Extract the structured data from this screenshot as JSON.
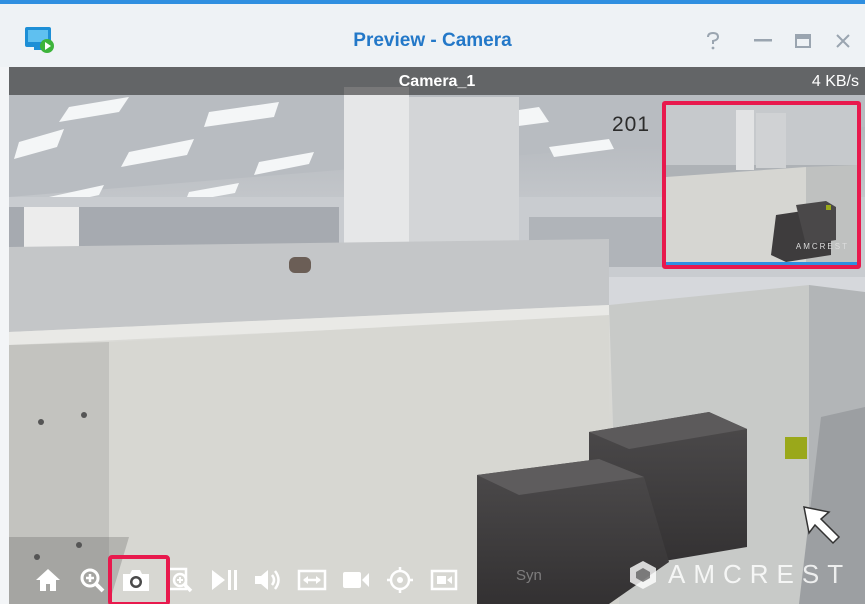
{
  "window": {
    "title": "Preview - Camera",
    "icon": "surveillance-app-icon",
    "controls": [
      "help-icon",
      "minimize-icon",
      "maximize-icon",
      "close-icon"
    ]
  },
  "camera": {
    "name": "Camera_1",
    "bitrate": "4 KB/s",
    "timestamp_partial": "201"
  },
  "pip": {
    "label": "",
    "logo": "AMCREST"
  },
  "toolbar": {
    "buttons": [
      "home-icon",
      "digital-zoom-icon",
      "snapshot-icon",
      "zoom-in-icon",
      "play-pause-icon",
      "volume-icon",
      "fit-window-icon",
      "record-icon",
      "ptz-icon",
      "stream-icon"
    ],
    "highlighted": "snapshot-icon"
  },
  "overlay": {
    "brand": "AMCREST",
    "watermark": "Syn"
  },
  "colors": {
    "accent": "#2f8fe0",
    "title": "#2378c8",
    "highlight": "#e8194d"
  }
}
